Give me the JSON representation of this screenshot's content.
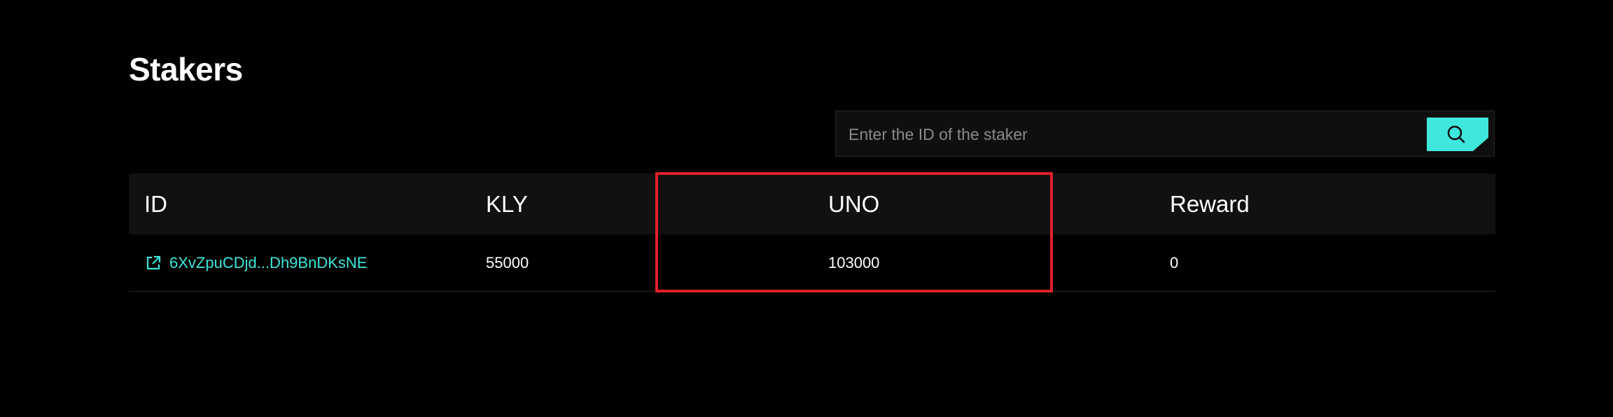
{
  "page": {
    "title": "Stakers"
  },
  "search": {
    "placeholder": "Enter the ID of the staker",
    "value": "",
    "button_icon": "search-icon"
  },
  "table": {
    "columns": [
      "ID",
      "KLY",
      "UNO",
      "Reward"
    ],
    "rows": [
      {
        "id": "6XvZpuCDjd...Dh9BnDKsNE",
        "id_icon": "external-link-icon",
        "kly": "55000",
        "uno": "103000",
        "reward": "0"
      }
    ]
  },
  "colors": {
    "background": "#000000",
    "accent": "#3ee6dc",
    "highlight": "#e0202a",
    "header_bg": "#111111"
  }
}
